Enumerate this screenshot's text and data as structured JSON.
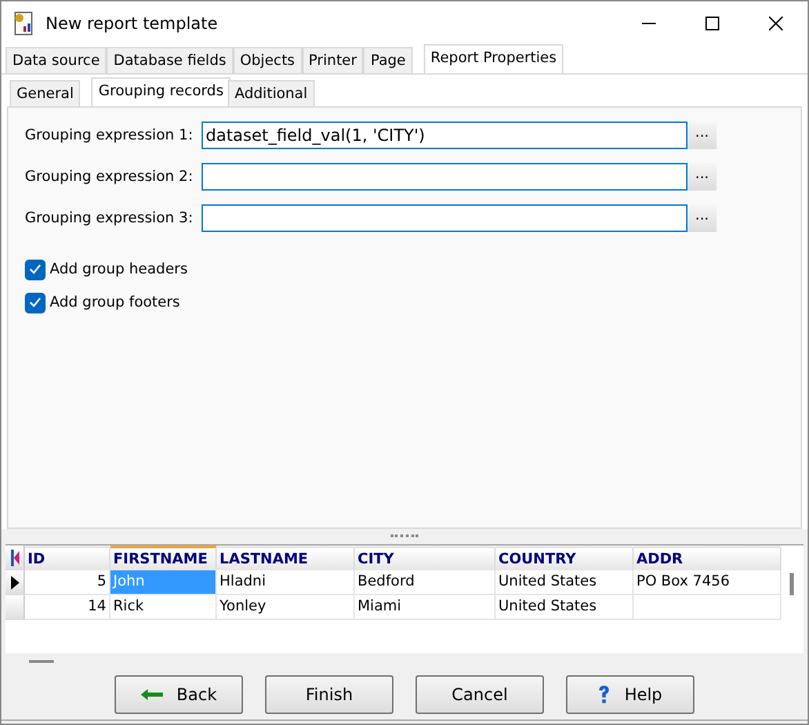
{
  "window": {
    "title": "New report template"
  },
  "tabs": [
    {
      "label": "Data source",
      "selected": false
    },
    {
      "label": "Database fields",
      "selected": false
    },
    {
      "label": "Objects",
      "selected": false
    },
    {
      "label": "Printer",
      "selected": false
    },
    {
      "label": "Page",
      "selected": false
    },
    {
      "label": "Report Properties",
      "selected": true
    }
  ],
  "subtabs": [
    {
      "label": "General",
      "selected": false
    },
    {
      "label": "Grouping records",
      "selected": true
    },
    {
      "label": "Additional",
      "selected": false
    }
  ],
  "expressions": [
    {
      "label": "Grouping expression 1:",
      "value": "dataset_field_val(1, 'CITY')",
      "button": "..."
    },
    {
      "label": "Grouping expression 2:",
      "button": "..."
    },
    {
      "label": "Grouping expression 3:",
      "button": "..."
    }
  ],
  "options": [
    {
      "label": "Add group headers",
      "checked": true
    },
    {
      "label": "Add group footers",
      "checked": true
    }
  ],
  "grid": {
    "columns": [
      {
        "label": "ID",
        "selected": false
      },
      {
        "label": "FIRSTNAME",
        "selected": true
      },
      {
        "label": "LASTNAME",
        "selected": false
      },
      {
        "label": "CITY",
        "selected": false
      },
      {
        "label": "COUNTRY",
        "selected": false
      },
      {
        "label": "ADDR",
        "selected": false
      }
    ],
    "rows": [
      {
        "selected": true,
        "cells": [
          "5",
          "John",
          "Hladni",
          "Bedford",
          "United States",
          "PO Box 7456"
        ]
      },
      {
        "selected": false,
        "cells": [
          "14",
          "Rick",
          "Yonley",
          "Miami",
          "United States",
          ""
        ]
      }
    ]
  },
  "buttons": [
    {
      "kind": "back",
      "label": "Back"
    },
    {
      "kind": "plain",
      "label": "Finish"
    },
    {
      "kind": "plain",
      "label": "Cancel"
    },
    {
      "kind": "help",
      "label": "Help"
    }
  ]
}
